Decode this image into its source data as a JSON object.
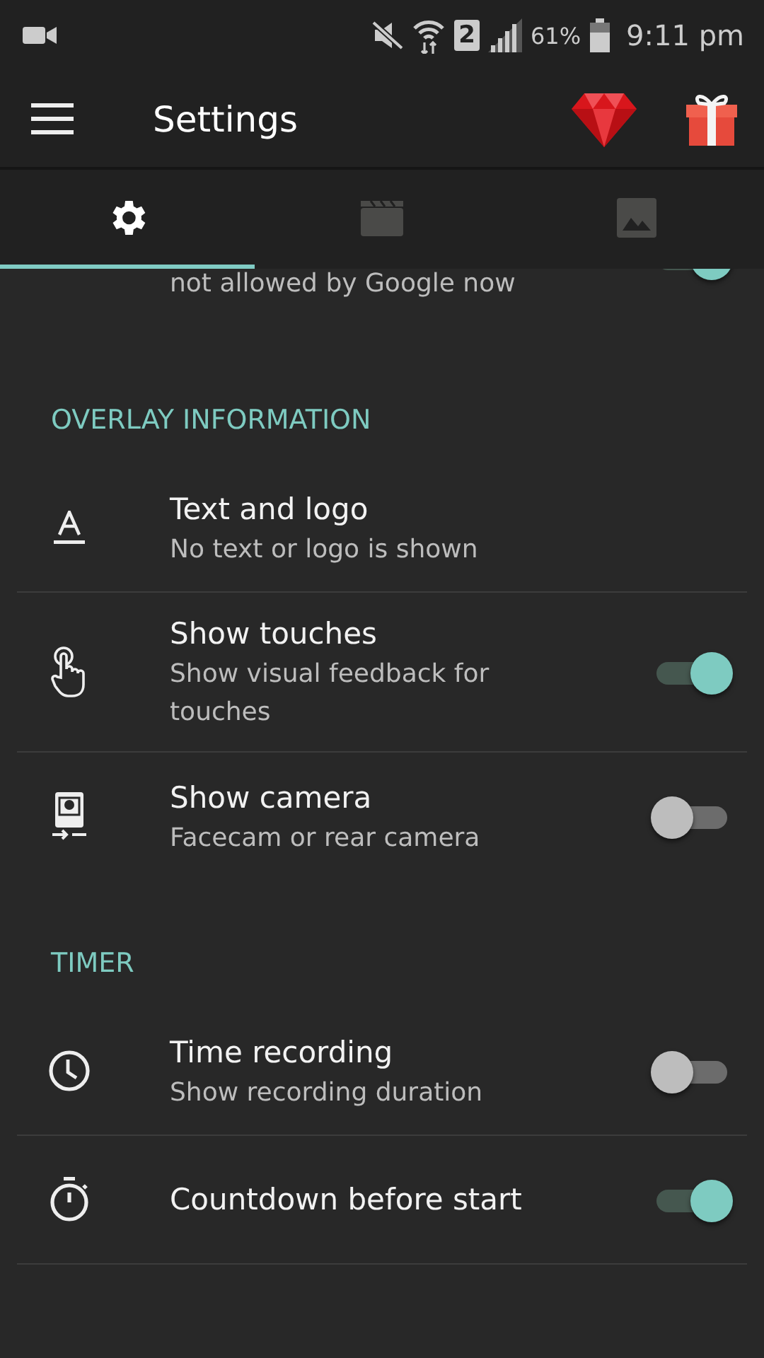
{
  "status_bar": {
    "sim": "2",
    "battery": "61%",
    "time": "9:11 pm"
  },
  "app_bar": {
    "title": "Settings"
  },
  "tabs": [
    {
      "selected": true
    },
    {
      "selected": false
    },
    {
      "selected": false
    }
  ],
  "partial_item": {
    "subtitle": "not allowed by Google now",
    "on": true
  },
  "sections": [
    {
      "header": "OVERLAY INFORMATION",
      "items": [
        {
          "kind": "plain",
          "title": "Text and logo",
          "subtitle": "No text or logo is shown"
        },
        {
          "kind": "toggle",
          "title": "Show touches",
          "subtitle": "Show visual feedback for touches",
          "on": true
        },
        {
          "kind": "toggle",
          "title": "Show camera",
          "subtitle": "Facecam or rear camera",
          "on": false
        }
      ]
    },
    {
      "header": "TIMER",
      "items": [
        {
          "kind": "toggle",
          "title": "Time recording",
          "subtitle": "Show recording duration",
          "on": false
        },
        {
          "kind": "toggle",
          "title": "Countdown before start",
          "on": true
        }
      ]
    }
  ]
}
